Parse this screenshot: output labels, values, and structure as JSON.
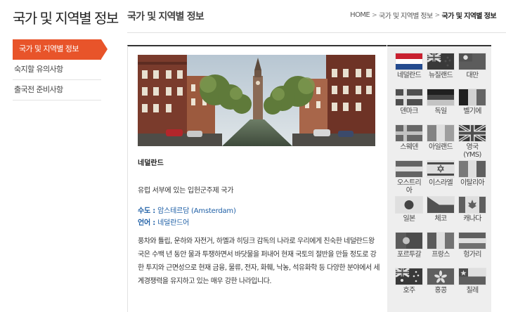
{
  "sidebar": {
    "title": "국가 및 지역별 정보",
    "items": [
      {
        "label": "국가 및 지역별 정보"
      },
      {
        "label": "숙지할 유의사항"
      },
      {
        "label": "출국전 준비사항"
      }
    ]
  },
  "header": {
    "title": "국가 및 지역별 정보",
    "breadcrumb": [
      "HOME",
      "국가 및 지역별 정보",
      "국가 및 지역별 정보"
    ],
    "breadcrumb_sep": ">"
  },
  "country": {
    "name": "네덜란드",
    "summary": "유럽 서부에 있는 입헌군주제 국가",
    "capital_label": "수도 :",
    "capital_value": "암스테르담 (Amsterdam)",
    "language_label": "언어 :",
    "language_value": "네덜란드어",
    "description": "풍차와 튤립, 운하와 자전거, 하멜과 히딩크 감독의 나라로 우리에게 친숙한 네덜란드왕국은 수백 년 동안 물과 투쟁하면서 바닷물을 퍼내어 현재 국토의 절반을 만들 정도로 강한 투지와 근면성으로 현재 금융, 물류, 전자, 화훼, 낙농, 석유화학 등 다양한 분야에서 세계경쟁력을 유지하고 있는 매우 강한 나라입니다."
  },
  "flags": [
    {
      "label": "네덜란드",
      "icon": "flag-netherlands-icon",
      "selected": true
    },
    {
      "label": "뉴질랜드",
      "icon": "flag-new-zealand-icon"
    },
    {
      "label": "대만",
      "icon": "flag-taiwan-icon"
    },
    {
      "label": "덴마크",
      "icon": "flag-denmark-icon"
    },
    {
      "label": "독일",
      "icon": "flag-germany-icon"
    },
    {
      "label": "벨기에",
      "icon": "flag-belgium-icon"
    },
    {
      "label": "스웨덴",
      "icon": "flag-sweden-icon"
    },
    {
      "label": "아일랜드",
      "icon": "flag-ireland-icon"
    },
    {
      "label": "영국(YMS)",
      "icon": "flag-uk-icon"
    },
    {
      "label": "오스트리아",
      "icon": "flag-austria-icon"
    },
    {
      "label": "이스라엘",
      "icon": "flag-israel-icon"
    },
    {
      "label": "이탈리아",
      "icon": "flag-italy-icon"
    },
    {
      "label": "일본",
      "icon": "flag-japan-icon"
    },
    {
      "label": "체코",
      "icon": "flag-czech-icon"
    },
    {
      "label": "캐나다",
      "icon": "flag-canada-icon"
    },
    {
      "label": "포르투갈",
      "icon": "flag-portugal-icon"
    },
    {
      "label": "프랑스",
      "icon": "flag-france-icon"
    },
    {
      "label": "헝가리",
      "icon": "flag-hungary-icon"
    },
    {
      "label": "호주",
      "icon": "flag-australia-icon"
    },
    {
      "label": "홍콩",
      "icon": "flag-hong-kong-icon"
    },
    {
      "label": "칠레",
      "icon": "flag-chile-icon"
    }
  ],
  "colors": {
    "accent": "#e8542a",
    "link": "#1e5fa6"
  }
}
